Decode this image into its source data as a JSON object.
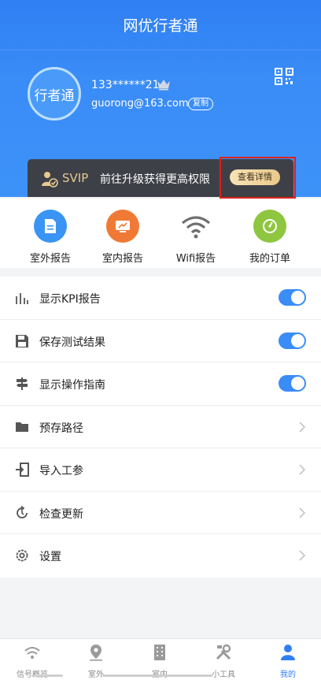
{
  "header": {
    "title": "网优行者通"
  },
  "user": {
    "avatar_text": "行者通",
    "phone": "133******21",
    "email": "guorong@163.com",
    "copy_label": "复制"
  },
  "svip": {
    "label": "SVIP",
    "promo_text": "前往升级获得更高权限",
    "detail_button": "查看详情"
  },
  "quick_actions": [
    {
      "label": "室外报告",
      "icon": "document-icon",
      "color": "#3a94f6"
    },
    {
      "label": "室内报告",
      "icon": "monitor-icon",
      "color": "#f07a35"
    },
    {
      "label": "Wifi报告",
      "icon": "wifi-icon",
      "color": "#6f6f6f"
    },
    {
      "label": "我的订单",
      "icon": "gauge-icon",
      "color": "#8fc63f"
    }
  ],
  "settings": [
    {
      "label": "显示KPI报告",
      "icon": "bar-chart-icon",
      "type": "toggle",
      "on": true
    },
    {
      "label": "保存测试结果",
      "icon": "save-icon",
      "type": "toggle",
      "on": true
    },
    {
      "label": "显示操作指南",
      "icon": "signpost-icon",
      "type": "toggle",
      "on": true
    },
    {
      "label": "预存路径",
      "icon": "folder-icon",
      "type": "link"
    },
    {
      "label": "导入工参",
      "icon": "import-icon",
      "type": "link"
    },
    {
      "label": "检查更新",
      "icon": "refresh-icon",
      "type": "link"
    },
    {
      "label": "设置",
      "icon": "gear-icon",
      "type": "link"
    }
  ],
  "tabbar": [
    {
      "label": "信号概览",
      "icon": "signal-icon",
      "active": false
    },
    {
      "label": "室外",
      "icon": "location-pin-icon",
      "active": false
    },
    {
      "label": "室内",
      "icon": "building-icon",
      "active": false
    },
    {
      "label": "小工具",
      "icon": "tools-icon",
      "active": false
    },
    {
      "label": "我的",
      "icon": "person-icon",
      "active": true
    }
  ],
  "colors": {
    "primary": "#2f7ff3",
    "svip_gold": "#e7c98f",
    "svip_bar": "#3d4047"
  }
}
